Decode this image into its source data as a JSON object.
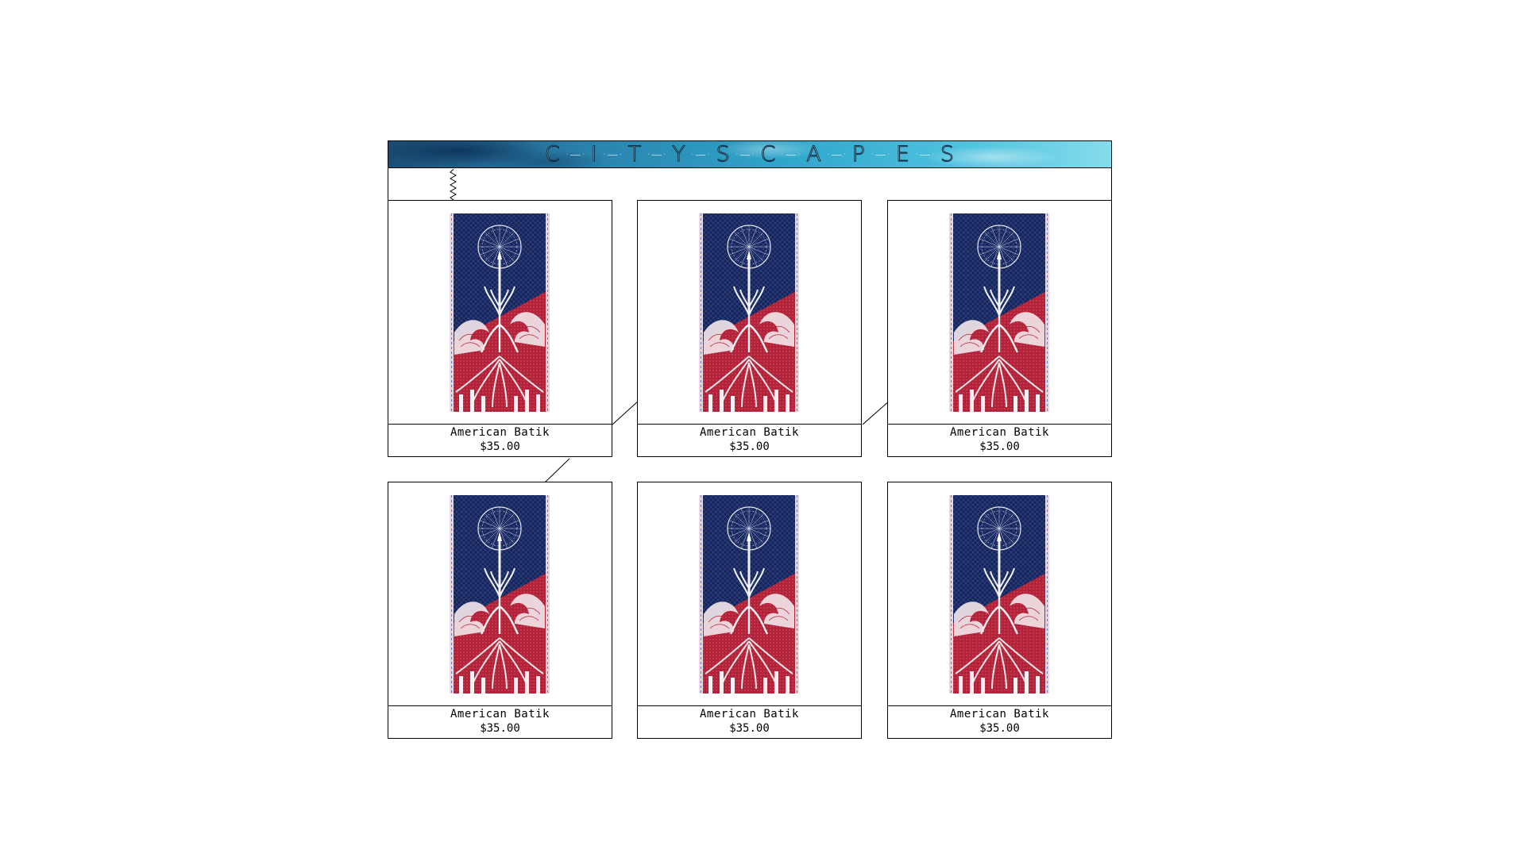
{
  "banner": {
    "letters": [
      "C",
      "I",
      "T",
      "Y",
      "S",
      "C",
      "A",
      "P",
      "E",
      "S"
    ]
  },
  "products": [
    {
      "name": "American Batik",
      "price": "$35.00"
    },
    {
      "name": "American Batik",
      "price": "$35.00"
    },
    {
      "name": "American Batik",
      "price": "$35.00"
    },
    {
      "name": "American Batik",
      "price": "$35.00"
    },
    {
      "name": "American Batik",
      "price": "$35.00"
    },
    {
      "name": "American Batik",
      "price": "$35.00"
    }
  ],
  "colors": {
    "poster_navy": "#15245a",
    "poster_red": "#b22238",
    "border": "#000000"
  }
}
